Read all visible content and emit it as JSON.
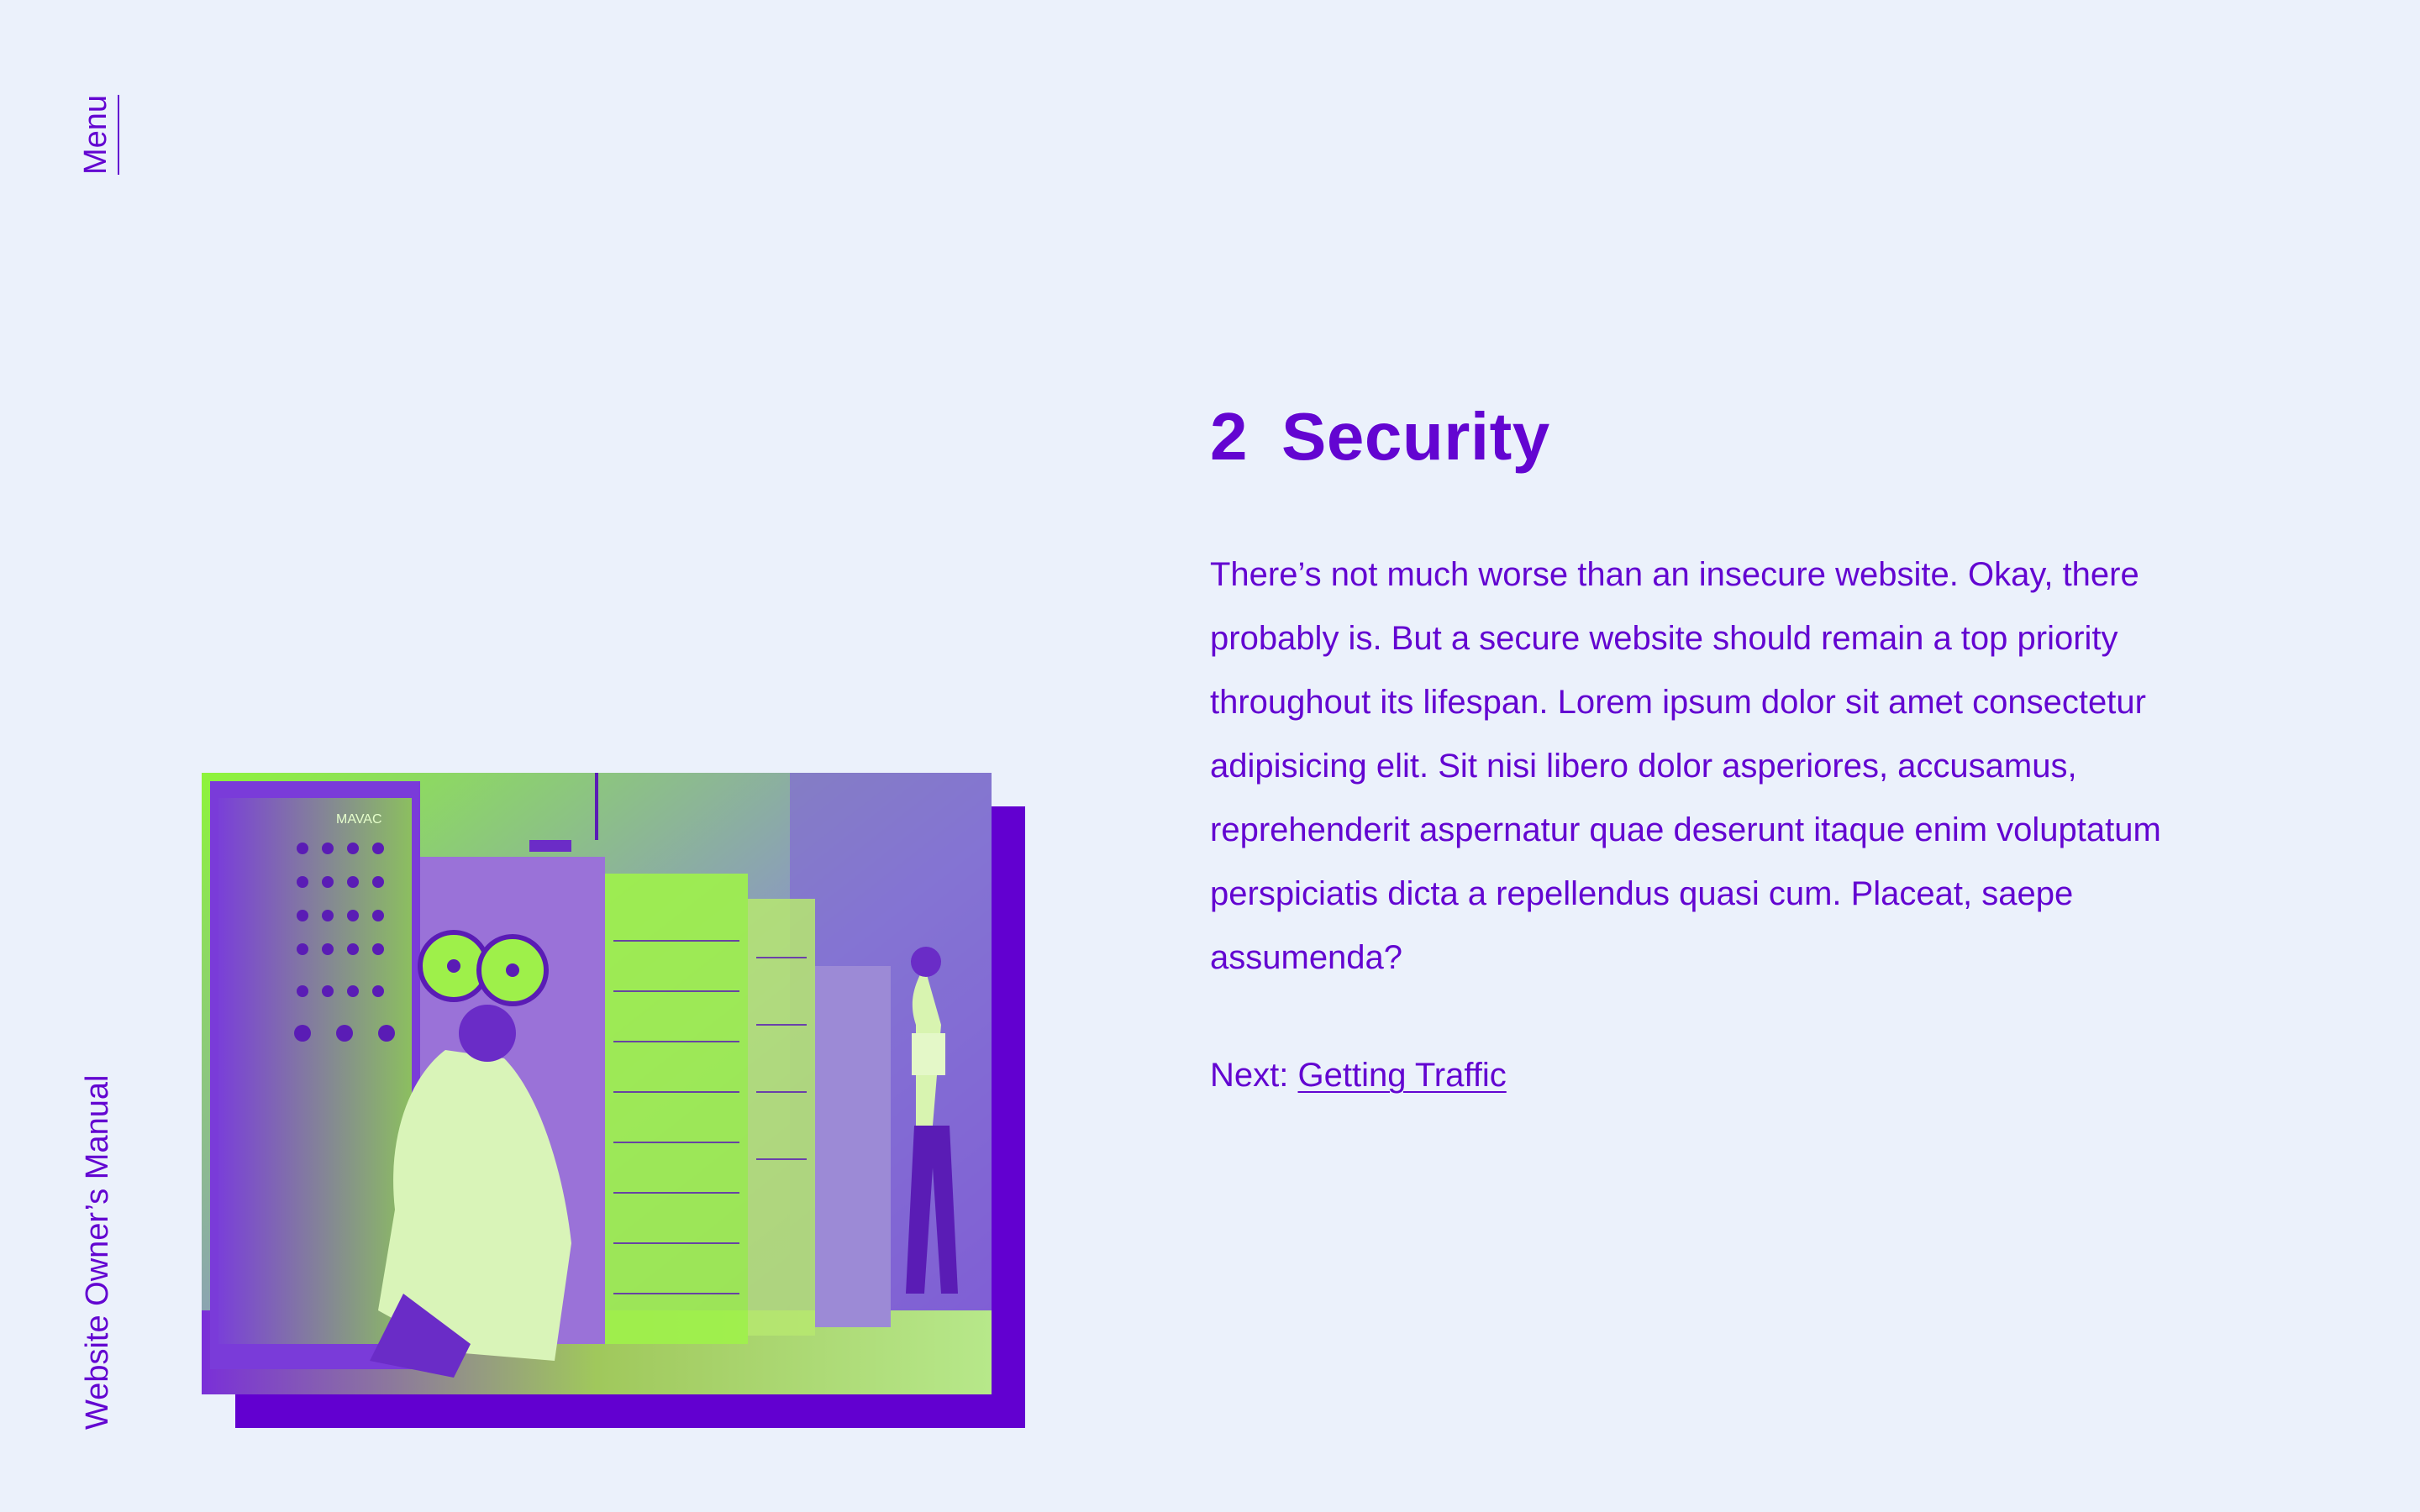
{
  "nav": {
    "menu_label": "Menu"
  },
  "site": {
    "name": "Website Owner’s Manual"
  },
  "chapter": {
    "number": "2",
    "title": "Security",
    "body": "There’s not much worse than an insecure website. Okay, there probably is. But a secure website should remain a top priority throughout its lifespan. Lorem ipsum dolor sit amet consectetur adipisicing elit. Sit nisi libero dolor asperiores, accusamus, reprehenderit aspernatur quae deserunt itaque enim voluptatum perspiciatis dicta a repellendus quasi cum. Placeat, saepe assumenda?",
    "next_prefix": "Next:",
    "next_link": "Getting Traffic"
  },
  "image": {
    "panel_label": "MAVAC"
  },
  "colors": {
    "background": "#ebf1fb",
    "accent": "#6305d1",
    "highlight": "#8ef43a"
  }
}
